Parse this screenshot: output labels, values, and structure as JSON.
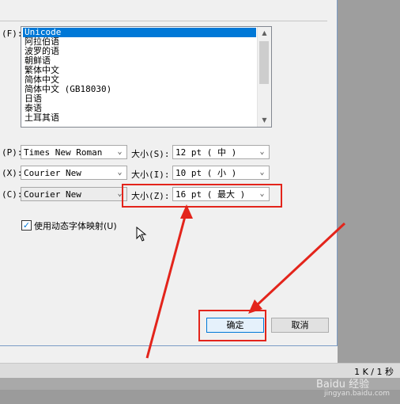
{
  "font_list": {
    "label": "(F):",
    "items": [
      "Unicode",
      "阿拉伯语",
      "波罗的语",
      "朝鲜语",
      "繁体中文",
      "简体中文",
      "简体中文 (GB18030)",
      "日语",
      "泰语",
      "土耳其语"
    ],
    "selected_index": 0
  },
  "rows": [
    {
      "label": "(P):",
      "font": "Times New Roman",
      "size_label": "大小(S):",
      "size": "12 pt ( 中 )"
    },
    {
      "label": "(X):",
      "font": "Courier New",
      "size_label": "大小(I):",
      "size": "10 pt ( 小 )"
    },
    {
      "label": "(C):",
      "font": "Courier New",
      "size_label": "大小(Z):",
      "size": "16 pt ( 最大 )"
    }
  ],
  "checkbox": {
    "label": "使用动态字体映射(U)",
    "checked": true,
    "mark": "✓"
  },
  "buttons": {
    "ok": "确定",
    "cancel": "取消"
  },
  "status": {
    "counter": "1 K / 1 秒"
  },
  "watermark": {
    "text": "Baidu 经验",
    "url": "jingyan.baidu.com"
  },
  "icons": {
    "down": "▼",
    "up": "▲",
    "chevron": "⌄"
  },
  "colors": {
    "highlight": "#e3241b",
    "selection": "#0078d7"
  }
}
